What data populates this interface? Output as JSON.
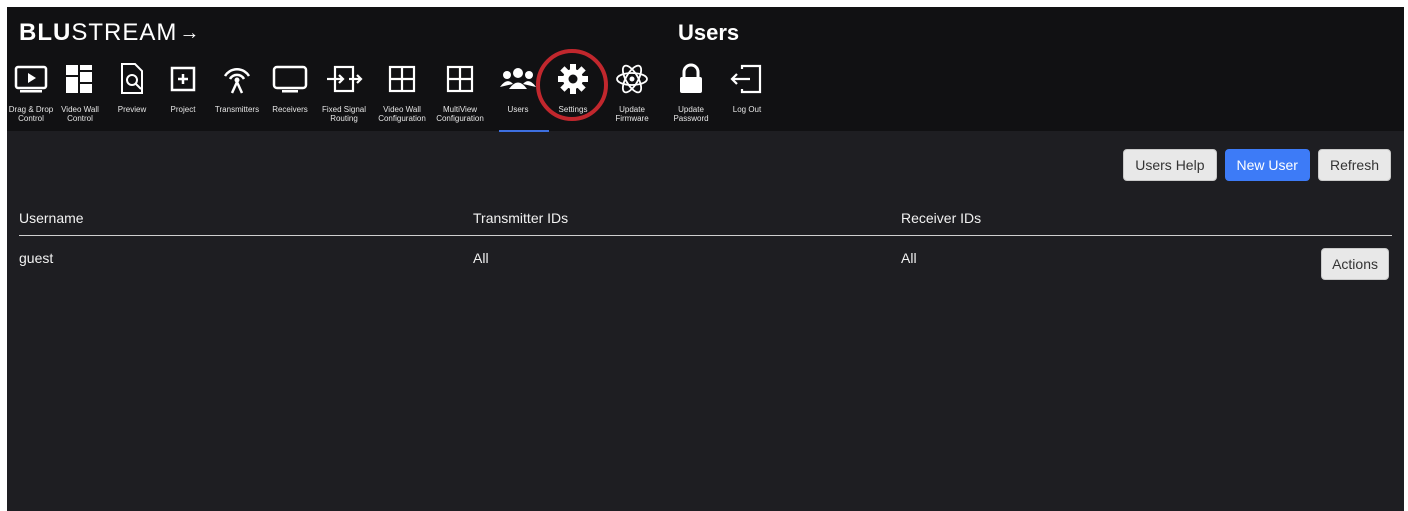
{
  "app": {
    "logo_bold": "BLU",
    "logo_rest": "STREAM",
    "logo_arrow": "→",
    "page_title": "Users"
  },
  "nav": [
    {
      "key": "drag-drop",
      "label": "Drag & Drop\nControl",
      "icon": "monitor-play-icon"
    },
    {
      "key": "video-wall-control",
      "label": "Video Wall\nControl",
      "icon": "video-wall-grid-icon"
    },
    {
      "key": "preview",
      "label": "Preview",
      "icon": "document-search-icon"
    },
    {
      "key": "project",
      "label": "Project",
      "icon": "plus-box-icon"
    },
    {
      "key": "transmitters",
      "label": "Transmitters",
      "icon": "antenna-icon"
    },
    {
      "key": "receivers",
      "label": "Receivers",
      "icon": "tv-icon"
    },
    {
      "key": "fixed-signal",
      "label": "Fixed Signal\nRouting",
      "icon": "routing-arrows-icon"
    },
    {
      "key": "video-wall-config",
      "label": "Video Wall\nConfiguration",
      "icon": "grid-4-icon"
    },
    {
      "key": "multiview-config",
      "label": "MultiView\nConfiguration",
      "icon": "grid-multiview-icon"
    },
    {
      "key": "users",
      "label": "Users",
      "icon": "users-group-icon",
      "active": true
    },
    {
      "key": "settings",
      "label": "Settings",
      "icon": "gear-icon"
    },
    {
      "key": "update-firmware",
      "label": "Update\nFirmware",
      "icon": "atom-icon"
    },
    {
      "key": "update-password",
      "label": "Update\nPassword",
      "icon": "lock-icon"
    },
    {
      "key": "log-out",
      "label": "Log Out",
      "icon": "logout-icon"
    }
  ],
  "toolbar": {
    "help_label": "Users Help",
    "new_label": "New User",
    "refresh_label": "Refresh"
  },
  "table": {
    "headers": [
      "Username",
      "Transmitter IDs",
      "Receiver IDs"
    ],
    "rows": [
      {
        "username": "guest",
        "transmitters": "All",
        "receivers": "All",
        "action": "Actions"
      }
    ]
  },
  "colors": {
    "accent": "#3d7bf7",
    "highlight_ring": "#c1272d",
    "background": "#1e1e22",
    "topbar": "#111113"
  }
}
